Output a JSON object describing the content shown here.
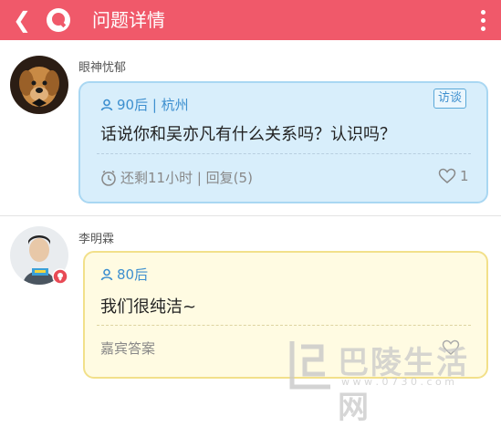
{
  "header": {
    "back_glyph": "❮",
    "title": "问题详情",
    "background": "#f0596a"
  },
  "question": {
    "username": "眼神忧郁",
    "age_location": "90后 | 杭州",
    "tag": "访谈",
    "text": "话说你和吴亦凡有什么关系吗？认识吗？",
    "remaining": "还剩11小时 | 回复(5)",
    "likes": "1",
    "bubble_color": "#d8eefb"
  },
  "answer": {
    "username": "李明霖",
    "age": "80后",
    "text": "我们很纯洁~",
    "role": "嘉宾答案",
    "bubble_color": "#fffbe2"
  },
  "watermark": {
    "text": "巴陵生活网",
    "sub": "w w w . 0 7 3 0 . c o m"
  },
  "icons": [
    "back-icon",
    "logo-icon",
    "more-icon",
    "person-icon",
    "clock-icon",
    "heart-icon"
  ]
}
